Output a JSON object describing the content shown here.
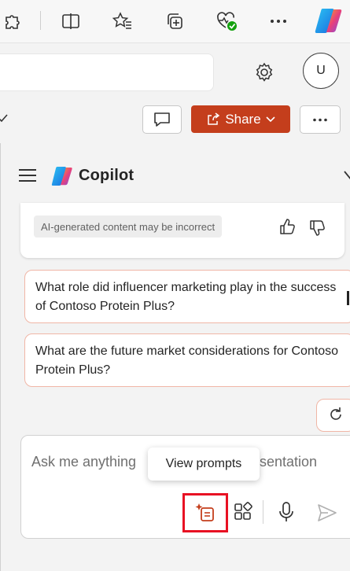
{
  "browser_toolbar": {
    "icons": [
      "extensions-icon",
      "split-screen-icon",
      "favorites-icon",
      "collections-icon",
      "browser-essentials-icon",
      "more-icon",
      "copilot-logo-icon"
    ]
  },
  "header": {
    "avatar_initial": "U",
    "share_label": "Share"
  },
  "copilot": {
    "title": "Copilot",
    "disclaimer": "AI-generated content may be incorrect",
    "suggestions": [
      "What role did influencer marketing play in the success of Contoso Protein Plus?",
      "What are the future market considerations for Contoso Protein Plus?"
    ],
    "compose_placeholder_left": "Ask me anything",
    "compose_placeholder_right": "sentation",
    "tooltip": "View prompts"
  },
  "colors": {
    "share_button": "#c43e1c",
    "suggestion_border": "#f0b6a6",
    "highlight_box": "#e81123"
  }
}
